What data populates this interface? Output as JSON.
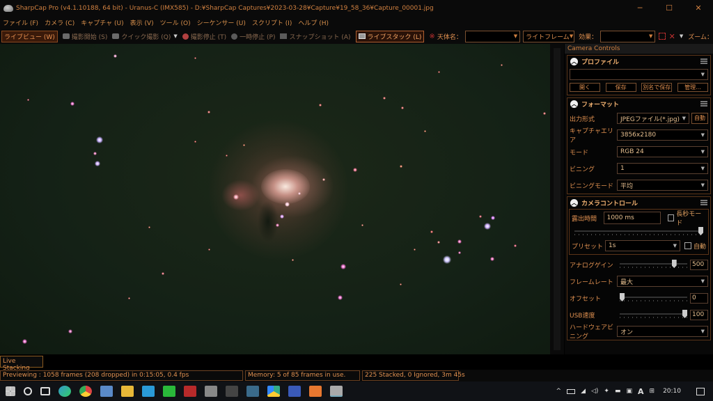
{
  "window": {
    "title": "SharpCap Pro (v4.1.10188, 64 bit) - Uranus-C (IMX585) - D:¥SharpCap Captures¥2023-03-28¥Capture¥19_58_36¥Capture_00001.jpg",
    "min": "─",
    "max": "☐",
    "close": "✕"
  },
  "menu": [
    "ファイル (F)",
    "カメラ (C)",
    "キャプチャ (U)",
    "表示 (V)",
    "ツール (O)",
    "シーケンサー (U)",
    "スクリプト (I)",
    "ヘルプ (H)"
  ],
  "toolbar": {
    "live_view": "ライブビュー (W)",
    "start_capture": "撮影開始 (S)",
    "quick_capture": "クイック撮影 (Q)",
    "stop_capture": "撮影停止 (T)",
    "pause": "一時停止 (P)",
    "snapshot": "スナップショット (A)",
    "live_stack": "ライブスタック (L)",
    "target_label": "天体名：",
    "target_value": "",
    "frame_type": "ライトフレーム",
    "effect_label": "効果：",
    "effect_value": "",
    "zoom_label": "ズーム："
  },
  "panel": {
    "title": "Camera Controls",
    "profile": {
      "header": "プロファイル",
      "value": "",
      "buttons": [
        "開く",
        "保存",
        "別名で保存",
        "管理..."
      ]
    },
    "format": {
      "header": "フォーマット",
      "output_label": "出力形式",
      "output_value": "JPEGファイル(*.jpg)",
      "auto_label": "自動",
      "area_label": "キャプチャエリア",
      "area_value": "3856x2180",
      "mode_label": "モード",
      "mode_value": "RGB 24",
      "binning_label": "ビニング",
      "binning_value": "1",
      "binmode_label": "ビニングモード",
      "binmode_value": "平均"
    },
    "camera": {
      "header": "カメラコントロール",
      "exposure_label": "露出時間",
      "exposure_value": "1000 ms",
      "longexp_label": "長秒モード",
      "preset_label": "プリセット",
      "preset_value": "1s",
      "preset_auto": "自動",
      "gain_label": "アナログゲイン",
      "gain_value": "500",
      "gain_level": 0.83,
      "framerate_label": "フレームレート",
      "framerate_value": "最大",
      "offset_label": "オフセット",
      "offset_value": "0",
      "offset_level": 0.0,
      "usb_label": "USB速度",
      "usb_value": "100",
      "usb_level": 1.0,
      "hwbin_label": "ハードウェアビニング",
      "hwbin_value": "オン"
    }
  },
  "live_stacking_tab": "Live Stacking",
  "status": {
    "previewing": "Previewing : 1058 frames (208 dropped) in 0:15:05, 0.4 fps",
    "memory": "Memory: 5 of 85 frames in use.",
    "stacked": "225 Stacked, 0 Ignored, 3m 45s"
  },
  "taskbar": {
    "time": "20:10",
    "tray_chevron": "^",
    "ime": "A"
  },
  "colors": {
    "accent": "#e09050",
    "background": "#0a0a0a",
    "sky": "#142116",
    "nebula": "#c87868"
  }
}
